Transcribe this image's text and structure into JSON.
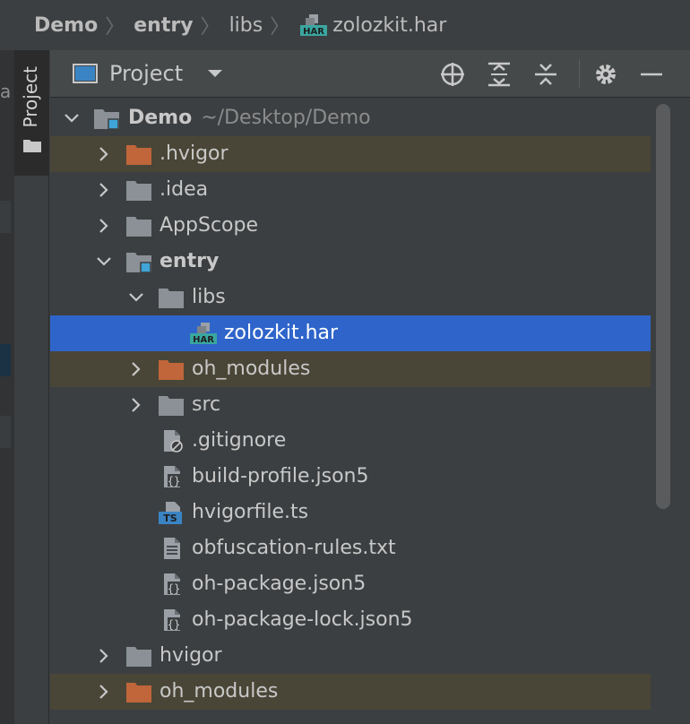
{
  "breadcrumb": {
    "items": [
      "Demo",
      "entry",
      "libs",
      "zolozkit.har"
    ]
  },
  "stripe": {
    "letter": "a"
  },
  "sidebar": {
    "tab_label": "Project"
  },
  "panel": {
    "title": "Project"
  },
  "tree": {
    "root": {
      "label": "Demo",
      "path": "~/Desktop/Demo"
    },
    "rows": [
      {
        "label": ".hvigor",
        "icon": "folder-icon-orange",
        "expanded": false
      },
      {
        "label": ".idea",
        "icon": "folder-icon",
        "expanded": false
      },
      {
        "label": "AppScope",
        "icon": "folder-icon",
        "expanded": false
      },
      {
        "label": "entry",
        "icon": "module-folder-icon",
        "expanded": true
      },
      {
        "label": "libs",
        "icon": "folder-icon",
        "expanded": true
      },
      {
        "label": "zolozkit.har",
        "icon": "har-file-icon"
      },
      {
        "label": "oh_modules",
        "icon": "folder-icon-orange",
        "expanded": false
      },
      {
        "label": "src",
        "icon": "folder-icon",
        "expanded": false
      },
      {
        "label": ".gitignore",
        "icon": "gitignore-file-icon"
      },
      {
        "label": "build-profile.json5",
        "icon": "json-file-icon"
      },
      {
        "label": "hvigorfile.ts",
        "icon": "ts-file-icon"
      },
      {
        "label": "obfuscation-rules.txt",
        "icon": "text-file-icon"
      },
      {
        "label": "oh-package.json5",
        "icon": "json-file-icon"
      },
      {
        "label": "oh-package-lock.json5",
        "icon": "json-file-icon"
      },
      {
        "label": "hvigor",
        "icon": "folder-icon",
        "expanded": false
      },
      {
        "label": "oh_modules",
        "icon": "folder-icon-orange",
        "expanded": false
      }
    ]
  },
  "colors": {
    "background": "#3c3f41",
    "selection": "#2f65ca",
    "excluded": "#4a4637",
    "excluded_folder": "#c0663a",
    "folder": "#8b9196",
    "module_badge": "#3fa5d8",
    "har_badge": "#3aa6a0"
  }
}
